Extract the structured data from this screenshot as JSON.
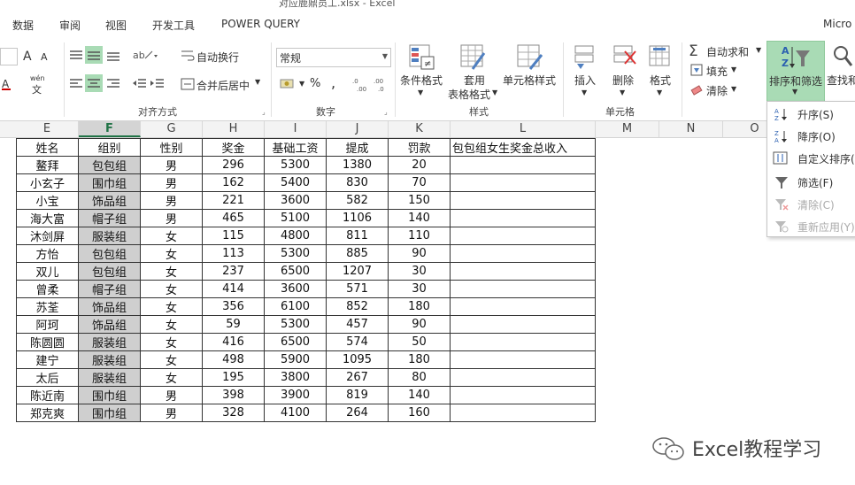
{
  "window": {
    "title": "对应鹿鼎员工.xlsx - Excel"
  },
  "menu": [
    "数据",
    "审阅",
    "视图",
    "开发工具",
    "POWER QUERY",
    "Micro"
  ],
  "ribbon": {
    "alignment_group": "对齐方式",
    "wrap_text": "自动换行",
    "merge_center": "合并后居中",
    "number_group": "数字",
    "number_format": "常规",
    "percent_symbol": "%",
    "comma_symbol": ",",
    "conditional_format": "条件格式",
    "format_table_1": "套用",
    "format_table_2": "表格格式",
    "cell_styles": "单元格样式",
    "styles_group": "样式",
    "insert": "插入",
    "delete": "删除",
    "format": "格式",
    "cells_group": "单元格",
    "autosum": "自动求和",
    "fill": "填充",
    "clear": "清除",
    "sort_filter": "排序和筛选",
    "find_select": "查找和",
    "font_a_large": "A",
    "font_a_small": "A",
    "wen": "wén",
    "wen_char": "文"
  },
  "columns": [
    {
      "letter": "E",
      "selected": false
    },
    {
      "letter": "F",
      "selected": true
    },
    {
      "letter": "G",
      "selected": false
    },
    {
      "letter": "H",
      "selected": false
    },
    {
      "letter": "I",
      "selected": false
    },
    {
      "letter": "J",
      "selected": false
    },
    {
      "letter": "K",
      "selected": false
    },
    {
      "letter": "L",
      "selected": false
    },
    {
      "letter": "M",
      "selected": false
    },
    {
      "letter": "N",
      "selected": false
    },
    {
      "letter": "O",
      "selected": false
    }
  ],
  "table": {
    "headers": [
      "姓名",
      "组别",
      "性别",
      "奖金",
      "基础工资",
      "提成",
      "罚款",
      "包包组女生奖金总收入"
    ],
    "rows": [
      [
        "鳌拜",
        "包包组",
        "男",
        "296",
        "5300",
        "1380",
        "20",
        ""
      ],
      [
        "小玄子",
        "围巾组",
        "男",
        "162",
        "5400",
        "830",
        "70",
        ""
      ],
      [
        "小宝",
        "饰品组",
        "男",
        "221",
        "3600",
        "582",
        "150",
        ""
      ],
      [
        "海大富",
        "帽子组",
        "男",
        "465",
        "5100",
        "1106",
        "140",
        ""
      ],
      [
        "沐剑屏",
        "服装组",
        "女",
        "115",
        "4800",
        "811",
        "110",
        ""
      ],
      [
        "方怡",
        "包包组",
        "女",
        "113",
        "5300",
        "885",
        "90",
        ""
      ],
      [
        "双儿",
        "包包组",
        "女",
        "237",
        "6500",
        "1207",
        "30",
        ""
      ],
      [
        "曾柔",
        "帽子组",
        "女",
        "414",
        "3600",
        "571",
        "30",
        ""
      ],
      [
        "苏荃",
        "饰品组",
        "女",
        "356",
        "6100",
        "852",
        "180",
        ""
      ],
      [
        "阿珂",
        "饰品组",
        "女",
        "59",
        "5300",
        "457",
        "90",
        ""
      ],
      [
        "陈圆圆",
        "服装组",
        "女",
        "416",
        "6500",
        "574",
        "50",
        ""
      ],
      [
        "建宁",
        "服装组",
        "女",
        "498",
        "5900",
        "1095",
        "180",
        ""
      ],
      [
        "太后",
        "服装组",
        "女",
        "195",
        "3800",
        "267",
        "80",
        ""
      ],
      [
        "陈近南",
        "围巾组",
        "男",
        "398",
        "3900",
        "819",
        "140",
        ""
      ],
      [
        "郑克爽",
        "围巾组",
        "男",
        "328",
        "4100",
        "264",
        "160",
        ""
      ]
    ]
  },
  "sort_menu": [
    {
      "label": "升序(S)",
      "icon": "sort-ascending-icon",
      "enabled": true
    },
    {
      "label": "降序(O)",
      "icon": "sort-descending-icon",
      "enabled": true
    },
    {
      "label": "自定义排序(U)",
      "icon": "custom-sort-icon",
      "enabled": true
    },
    {
      "label": "筛选(F)",
      "icon": "filter-icon",
      "enabled": true
    },
    {
      "label": "清除(C)",
      "icon": "clear-filter-icon",
      "enabled": false
    },
    {
      "label": "重新应用(Y)",
      "icon": "reapply-icon",
      "enabled": false
    }
  ],
  "watermark": {
    "text": "Excel教程学习"
  },
  "colors": {
    "selected_column": "#cfcfcf",
    "sort_button": "#a9dbb5",
    "excel_green": "#217346"
  }
}
